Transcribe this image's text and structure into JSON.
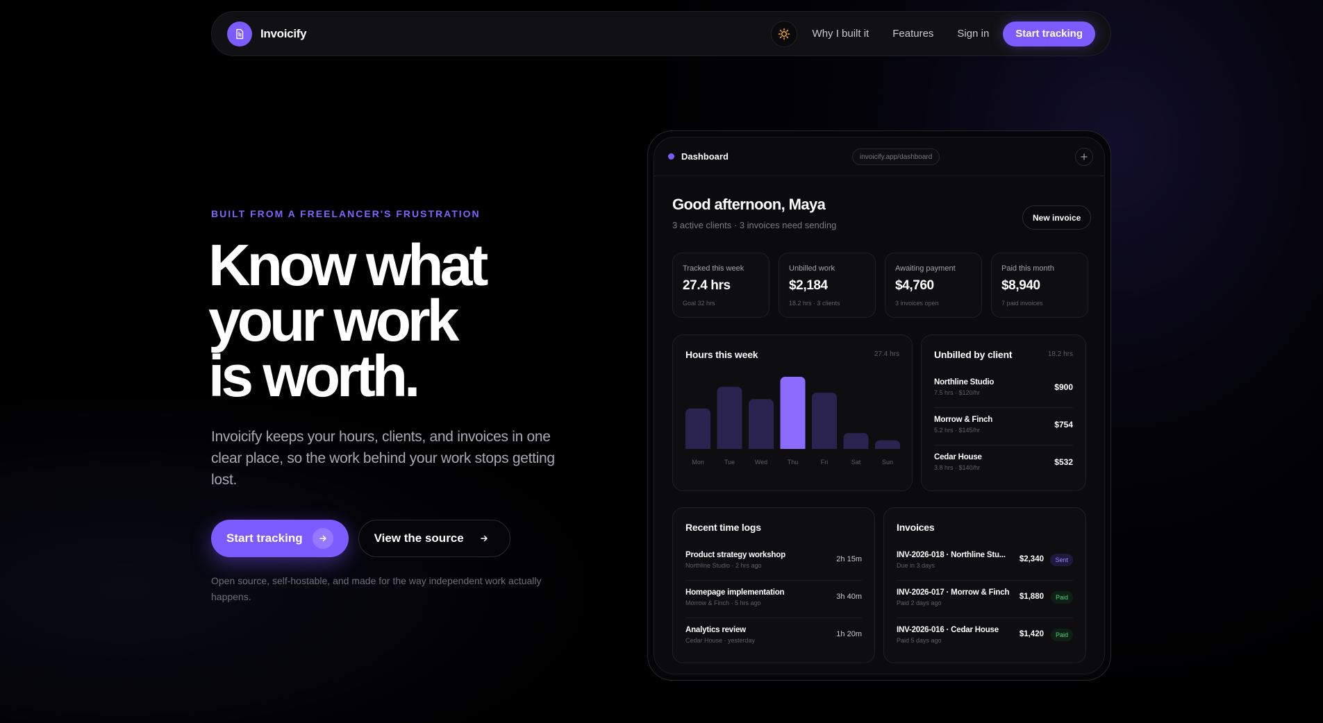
{
  "nav": {
    "brand": "Invoicify",
    "links": [
      "Why I built it",
      "Features",
      "Sign in"
    ],
    "cta": "Start tracking"
  },
  "hero": {
    "eyebrow": "BUILT FROM A FREELANCER'S FRUSTRATION",
    "headline_lines": [
      "Know what",
      "your work",
      "is worth."
    ],
    "lede": "Invoicify keeps your hours, clients, and invoices in one clear place, so the work behind your work stops getting lost.",
    "primary_cta": "Start tracking",
    "secondary_cta": "View the source",
    "footnote": "Open source, self-hostable, and made for the way independent work actually happens."
  },
  "dashboard": {
    "title": "Dashboard",
    "url": "invoicify.app/dashboard",
    "greeting": "Good afternoon, Maya",
    "subtitle": "3 active clients · 3 invoices need sending",
    "new_invoice": "New invoice",
    "stats": [
      {
        "label": "Tracked this week",
        "value": "27.4 hrs",
        "sub": "Goal 32 hrs"
      },
      {
        "label": "Unbilled work",
        "value": "$2,184",
        "sub": "18.2 hrs · 3 clients"
      },
      {
        "label": "Awaiting payment",
        "value": "$4,760",
        "sub": "3 invoices open"
      },
      {
        "label": "Paid this month",
        "value": "$8,940",
        "sub": "7 paid invoices"
      }
    ],
    "hours_card": {
      "title": "Hours this week",
      "meta": "27.4 hrs"
    },
    "unbilled_card": {
      "title": "Unbilled by client",
      "meta": "18.2 hrs",
      "rows": [
        {
          "name": "Northline Studio",
          "sub": "7.5 hrs · $120/hr",
          "value": "$900"
        },
        {
          "name": "Morrow & Finch",
          "sub": "5.2 hrs · $145/hr",
          "value": "$754"
        },
        {
          "name": "Cedar House",
          "sub": "3.8 hrs · $140/hr",
          "value": "$532"
        }
      ]
    },
    "logs_card": {
      "title": "Recent time logs",
      "rows": [
        {
          "name": "Product strategy workshop",
          "sub": "Northline Studio · 2 hrs ago",
          "value": "2h 15m"
        },
        {
          "name": "Homepage implementation",
          "sub": "Morrow & Finch · 5 hrs ago",
          "value": "3h 40m"
        },
        {
          "name": "Analytics review",
          "sub": "Cedar House · yesterday",
          "value": "1h 20m"
        }
      ]
    },
    "invoices_card": {
      "title": "Invoices",
      "rows": [
        {
          "name": "INV-2026-018 · Northline Stu...",
          "sub": "Due in 3 days",
          "amount": "$2,340",
          "status": "Sent"
        },
        {
          "name": "INV-2026-017 · Morrow & Finch",
          "sub": "Paid 2 days ago",
          "amount": "$1,880",
          "status": "Paid"
        },
        {
          "name": "INV-2026-016 · Cedar House",
          "sub": "Paid 5 days ago",
          "amount": "$1,420",
          "status": "Paid"
        }
      ]
    }
  },
  "colors": {
    "accent": "#7c5cff",
    "bar": "#2a2350",
    "bar_highlight": "#8b6cff",
    "paid": "#4fd47c"
  },
  "icons": {
    "logo": "document-icon",
    "theme": "sun-icon",
    "arrow": "arrow-right-icon",
    "plus": "plus-icon"
  },
  "chart_data": {
    "type": "bar",
    "categories": [
      "Mon",
      "Tue",
      "Wed",
      "Thu",
      "Fri",
      "Sat",
      "Sun"
    ],
    "values": [
      5.6,
      8.6,
      6.9,
      10.0,
      7.8,
      2.2,
      1.2
    ],
    "highlight": "Thu"
  }
}
